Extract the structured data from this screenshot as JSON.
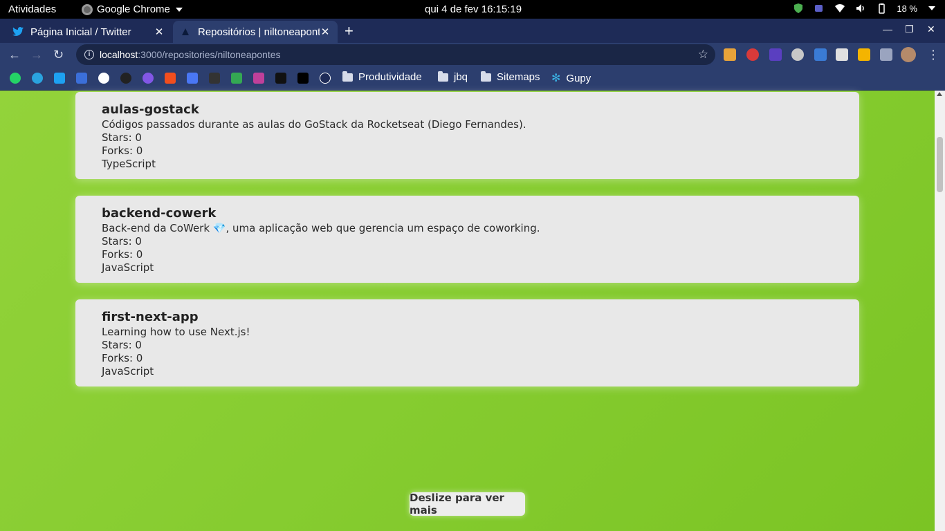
{
  "topbar": {
    "activities": "Atividades",
    "app_name": "Google Chrome",
    "clock": "qui 4 de fev  16:15:19",
    "battery": "18 %"
  },
  "tabs": [
    {
      "title": "Página Inicial / Twitter",
      "icon": "twitter-icon"
    },
    {
      "title": "Repositórios | niltoneapontes",
      "icon": "site-icon"
    }
  ],
  "address": {
    "host": "localhost",
    "rest": ":3000/repositories/niltoneapontes"
  },
  "bookmarks": {
    "folders": [
      "Produtividade",
      "jbq",
      "Sitemaps"
    ],
    "gupy": "Gupy"
  },
  "repositories": [
    {
      "name": "aulas-gostack",
      "description": "Códigos passados durante as aulas do GoStack da Rocketseat (Diego Fernandes).",
      "stars": "Stars: 0",
      "forks": "Forks: 0",
      "language": "TypeScript"
    },
    {
      "name": "backend-cowerk",
      "description": "Back-end da CoWerk 💎, uma aplicação web que gerencia um espaço de coworking.",
      "stars": "Stars: 0",
      "forks": "Forks: 0",
      "language": "JavaScript"
    },
    {
      "name": "first-next-app",
      "description": "Learning how to use Next.js!",
      "stars": "Stars: 0",
      "forks": "Forks: 0",
      "language": "JavaScript"
    }
  ],
  "more_button": "Deslize para ver mais",
  "colors": {
    "page_background": "#86cc30",
    "card_background": "#e8e8e8",
    "browser_frame": "#2c3e6e"
  }
}
